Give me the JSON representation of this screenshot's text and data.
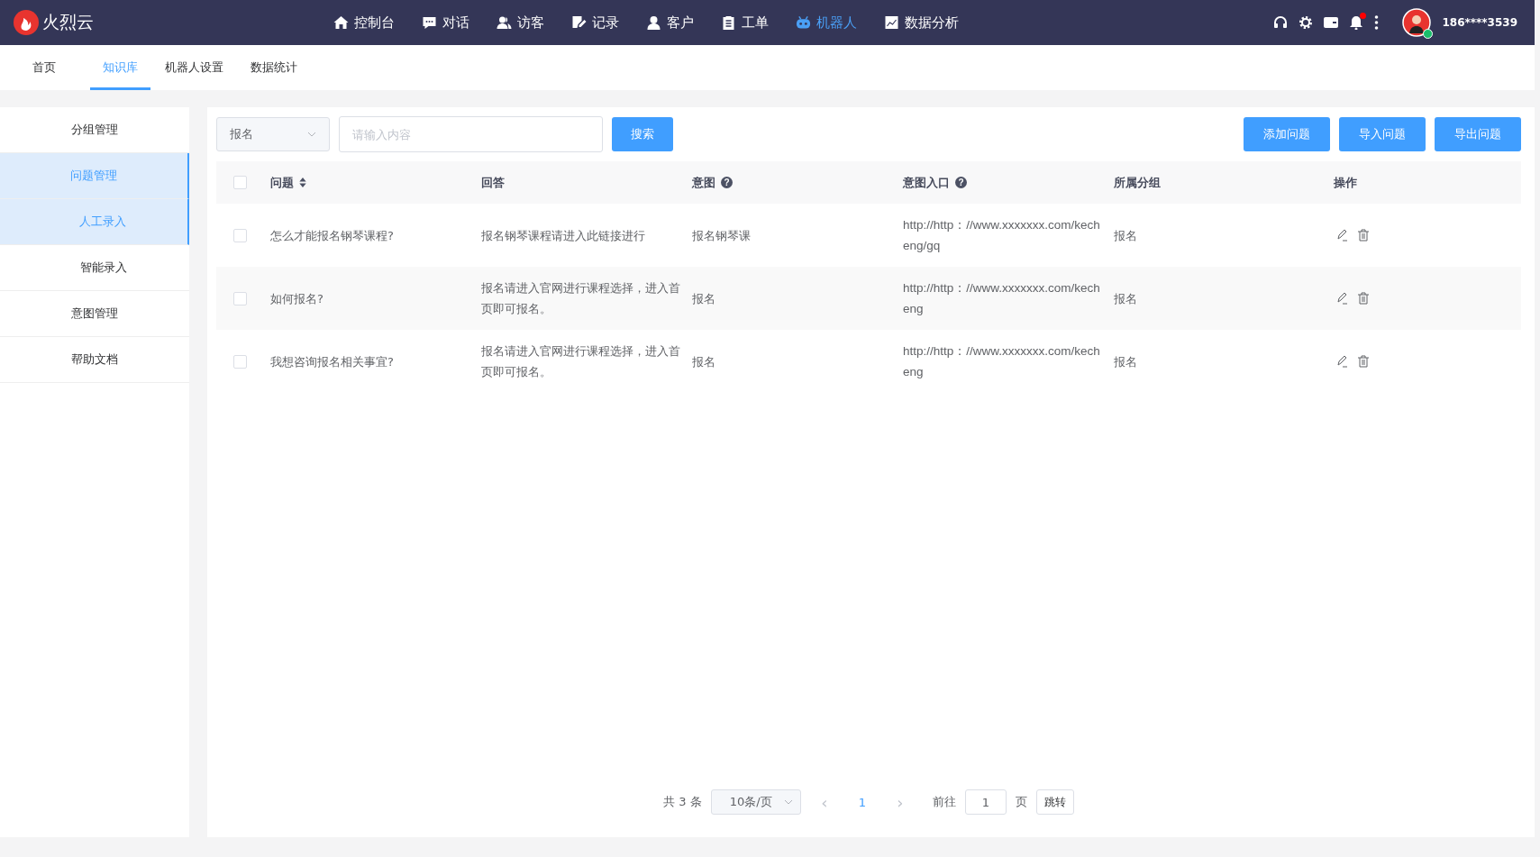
{
  "brand": {
    "name": "火烈云"
  },
  "nav": [
    {
      "label": "控制台",
      "selected": false
    },
    {
      "label": "对话",
      "selected": false
    },
    {
      "label": "访客",
      "selected": false
    },
    {
      "label": "记录",
      "selected": false
    },
    {
      "label": "客户",
      "selected": false
    },
    {
      "label": "工单",
      "selected": false
    },
    {
      "label": "机器人",
      "selected": true
    },
    {
      "label": "数据分析",
      "selected": false
    }
  ],
  "notification_badge": true,
  "user": {
    "name": "186****3539",
    "online": true
  },
  "subtabs": [
    {
      "label": "首页",
      "selected": false
    },
    {
      "label": "知识库",
      "selected": true
    },
    {
      "label": "机器人设置",
      "selected": false
    },
    {
      "label": "数据统计",
      "selected": false
    }
  ],
  "sidebar": {
    "items": [
      {
        "label": "分组管理",
        "selected": false
      },
      {
        "label": "问题管理",
        "selected": true,
        "children": [
          {
            "label": "人工录入",
            "selected": true
          },
          {
            "label": "智能录入",
            "selected": false
          }
        ]
      },
      {
        "label": "意图管理",
        "selected": false
      },
      {
        "label": "帮助文档",
        "selected": false
      }
    ]
  },
  "filter": {
    "select": "报名",
    "placeholder": "请输入内容",
    "search": "搜索"
  },
  "actions": [
    "添加问题",
    "导入问题",
    "导出问题"
  ],
  "table": {
    "columns": [
      {
        "label": "问题",
        "sortable": true
      },
      {
        "label": "回答",
        "sortable": false
      },
      {
        "label": "意图",
        "sortable": false,
        "help": "?"
      },
      {
        "label": "意图入口",
        "sortable": false,
        "help": "?"
      },
      {
        "label": "所属分组",
        "sortable": false
      },
      {
        "label": "操作",
        "sortable": false
      }
    ],
    "header_checked": false,
    "rows": [
      {
        "checked": false,
        "question": "怎么才能报名钢琴课程?",
        "answer": "报名钢琴课程请进入此链接进行",
        "intent": "报名钢琴课",
        "entry": "http://http：//www.xxxxxxx.com/kecheng/gq",
        "group": "报名"
      },
      {
        "checked": false,
        "question": "如何报名?",
        "answer": "报名请进入官网进行课程选择，进入首页即可报名。",
        "intent": "报名",
        "entry": "http://http：//www.xxxxxxx.com/kecheng",
        "group": "报名"
      },
      {
        "checked": false,
        "question": "我想咨询报名相关事宜?",
        "answer": "报名请进入官网进行课程选择，进入首页即可报名。",
        "intent": "报名",
        "entry": "http://http：//www.xxxxxxx.com/kecheng",
        "group": "报名"
      }
    ]
  },
  "pagination": {
    "total": "共 3 条",
    "page_size": "10条/页",
    "prev": "‹",
    "pages": [
      {
        "label": "1",
        "selected": true
      }
    ],
    "next": "›",
    "goto_label": "前往",
    "goto_value": "1",
    "page_unit": "页",
    "jump": "跳转"
  }
}
